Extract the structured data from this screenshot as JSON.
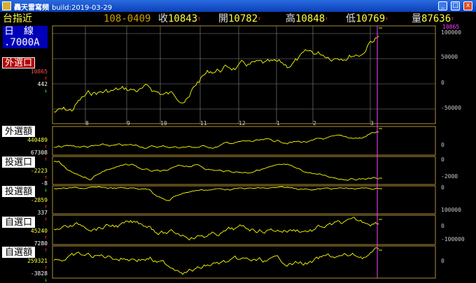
{
  "window": {
    "title": "轟天雷寫頻",
    "build": "build:2019-03-29",
    "buttons": {
      "minimize": "_",
      "maximize": "□",
      "close": "x"
    }
  },
  "quote": {
    "name": "台指近",
    "contract": "108-0409",
    "close_label": "收",
    "close_value": "10843",
    "open_label": "開",
    "open_value": "10782",
    "high_label": "高",
    "high_value": "10848",
    "low_label": "低",
    "low_value": "10769",
    "volume_label": "量",
    "volume_value": "87636",
    "arrow": "↑"
  },
  "panel": {
    "period": "日　線",
    "scale": ".7000A"
  },
  "subcharts": [
    {
      "label": "外選口",
      "v1": "10865",
      "v2": "442",
      "a1": "↑",
      "a2": "↓",
      "active": true
    },
    {
      "label": "外選額",
      "v1": "440489",
      "v2": "67308",
      "a1": "↑",
      "a2": "↑",
      "active": false
    },
    {
      "label": "投選口",
      "v1": "-2223",
      "v2": "-8",
      "a1": "↑",
      "a2": "↓",
      "active": false
    },
    {
      "label": "投選額",
      "v1": "-2859",
      "v2": "337",
      "a1": "↑",
      "a2": "↑",
      "active": false
    },
    {
      "label": "自選口",
      "v1": "45240",
      "v2": "7280",
      "a1": "↑",
      "a2": "↑",
      "active": false
    },
    {
      "label": "自選額",
      "v1": "259321",
      "v2": "-3828",
      "a1": "↑",
      "a2": "↓",
      "active": false
    }
  ],
  "axis": {
    "main_top": "10865",
    "main": [
      "100000",
      "50000",
      "0",
      "-50000"
    ],
    "p2": [
      "0"
    ],
    "p3": [
      "0",
      "-2000"
    ],
    "p4": [
      "0"
    ],
    "p5": [
      "100000",
      "0",
      "-100000"
    ],
    "p6": [
      "0"
    ],
    "months": [
      "8",
      "9",
      "10",
      "11",
      "12",
      "1",
      "2",
      "3"
    ]
  },
  "colors": {
    "line": "#ffff00",
    "grid": "#8a8a8a",
    "frame": "#d8b040",
    "cursor": "#ff40ff",
    "quote_value": "#ffff40",
    "up_arrow": "#ff3030",
    "down_arrow": "#30ff30"
  }
}
